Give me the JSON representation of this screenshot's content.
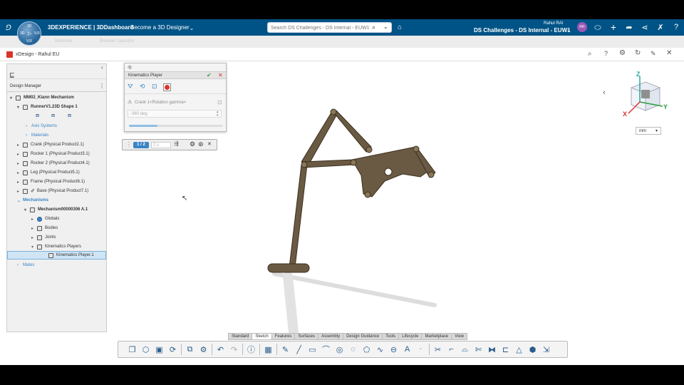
{
  "topbar": {
    "brand": "3DEXPERIENCE | ",
    "dashboard": "3DDashboard",
    "role": "Become a 3D Designer",
    "search_placeholder": "Search DS Challenges - DS Internal - EUW1",
    "user_name": "Rahul RAI",
    "tenant": "DS Challenges - DS Internal - EUW1",
    "avatar_initials": "RR"
  },
  "compass": {
    "top": "3D",
    "left": "3D",
    "right": "V,R",
    "bottom": "V,R"
  },
  "subbar": {
    "tab1": "Welcome",
    "tab2": "Browser Launcher"
  },
  "app": {
    "title": "xDesign - Rahul EU"
  },
  "tree": {
    "header": "Design Manager",
    "root": "MM02_Klann Mechanism",
    "shape": "RunnerV1.23D Shape 1",
    "axis": "Axis Systems",
    "materials": "Materials",
    "products": [
      "Crank (Physical Product2.1)",
      "Rocker 1 (Physical Product3.1)",
      "Rocker 2 (Physical Product4.1)",
      "Leg (Physical Product5.1)",
      "Frame (Physical Product6.1)",
      "Base (Physical Product7.1)"
    ],
    "mechanisms": "Mechanisms",
    "mechanism": "Mechanism00000306 A.1",
    "globals": "Globals",
    "bodies": "Bodies",
    "joints": "Joints",
    "players": "Kinematics Players",
    "player": "Kinematics Player.1",
    "mates": "Mates"
  },
  "kinematics": {
    "title": "Kinematics Player",
    "command": "Crank 1<Rotation gamma>",
    "value": "-360 deg"
  },
  "control": {
    "step": "1 / 2",
    "speed": "2 s"
  },
  "unit": "mm",
  "tabs": [
    "Standard",
    "Sketch",
    "Features",
    "Surfaces",
    "Assembly",
    "Design Guidance",
    "Tools",
    "Lifecycle",
    "Marketplace",
    "View"
  ],
  "active_tab": "Sketch",
  "axis_labels": {
    "x": "X",
    "y": "Y",
    "z": "Z"
  },
  "colors": {
    "topbar": "#005386",
    "part": "#6b5a43",
    "accent": "#3a84c5"
  }
}
